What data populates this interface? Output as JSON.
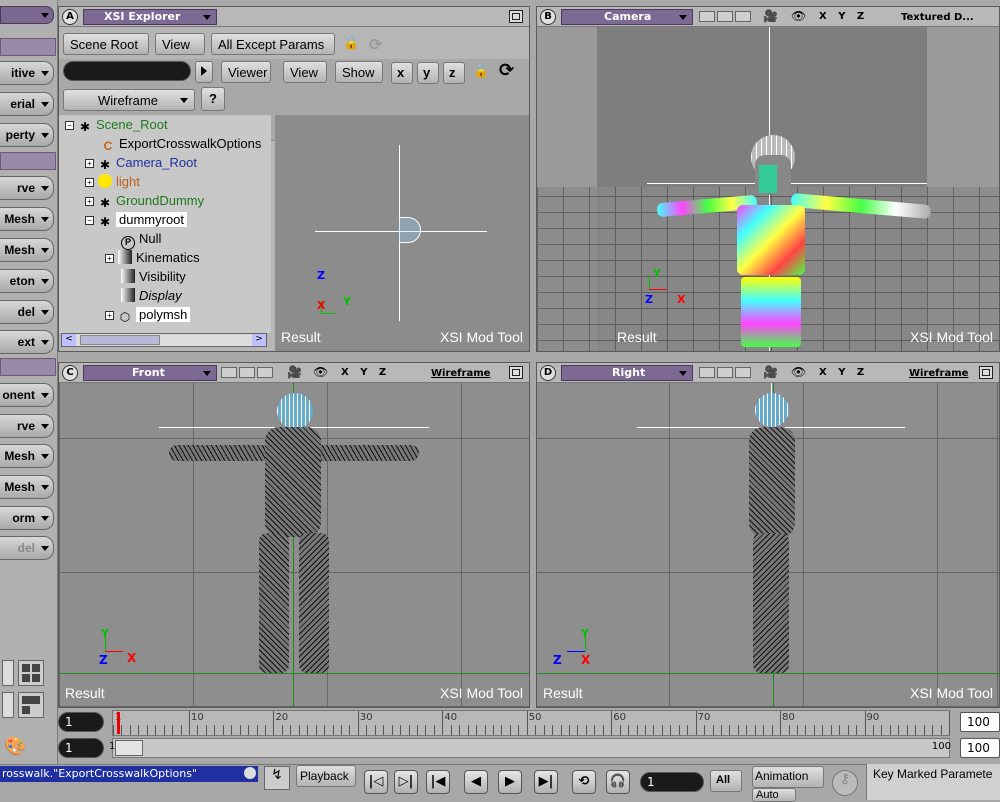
{
  "left_toolbar": {
    "items": [
      "itive",
      "erial",
      "perty",
      "rve",
      "Mesh",
      "Mesh",
      "eton",
      "del",
      "ext",
      "onent",
      "rve",
      "Mesh",
      "Mesh",
      "orm",
      "del"
    ]
  },
  "explorer": {
    "letter": "A",
    "title": "XSI Explorer",
    "scope_button": "Scene Root",
    "view_button": "View",
    "filter_button": "All Except Params",
    "viewer_button": "Viewer",
    "view2_button": "View",
    "show_button": "Show",
    "axis_x": "x",
    "axis_y": "y",
    "axis_z": "z",
    "wireframe_button": "Wireframe",
    "help_button": "?",
    "tree": [
      {
        "label": "Scene_Root",
        "color": "#1f7a1f"
      },
      {
        "label": "ExportCrosswalkOptions",
        "color": "#000000"
      },
      {
        "label": "Camera_Root",
        "color": "#2030a0"
      },
      {
        "label": "light",
        "color": "#c0601a"
      },
      {
        "label": "GroundDummy",
        "color": "#1f7a1f"
      },
      {
        "label": "dummyroot",
        "color": "#000000"
      },
      {
        "label": "Null",
        "color": "#000000"
      },
      {
        "label": "Kinematics",
        "color": "#000000"
      },
      {
        "label": "Visibility",
        "color": "#000000"
      },
      {
        "label": "Display",
        "color": "#000000"
      },
      {
        "label": "polymsh",
        "color": "#000000"
      }
    ],
    "mini_labels": {
      "result": "Result",
      "right": "XSI  Mod  Tool"
    },
    "mini_axes": {
      "z": "Z",
      "x": "X",
      "y": "Y"
    }
  },
  "viewports": {
    "b": {
      "letter": "B",
      "title": "Camera",
      "mode": "Textured D...",
      "xyz": "X Y Z"
    },
    "c": {
      "letter": "C",
      "title": "Front",
      "mode": "Wireframe",
      "xyz": "X Y Z"
    },
    "d": {
      "letter": "D",
      "title": "Right",
      "mode": "Wireframe",
      "xyz": "X Y Z"
    },
    "result_label": "Result",
    "tool_label": "XSI  Mod  Tool",
    "axis_z": "Z",
    "axis_x": "X",
    "axis_y": "Y"
  },
  "timeline": {
    "start_field": "1",
    "end_field": "100",
    "range_start": "1",
    "range_end": "100",
    "range_end_field": "100",
    "range_tick_start": "1",
    "range_tick_end": "100",
    "ticks": [
      "1",
      "10",
      "20",
      "30",
      "40",
      "50",
      "60",
      "70",
      "80",
      "90"
    ]
  },
  "playback": {
    "selection_text": "rosswalk.\"ExportCrosswalkOptions\"",
    "playback_button": "Playback",
    "frame_field": "1",
    "all_button": "All",
    "animation_button": "Animation",
    "auto_button": "Auto",
    "key_marked_label": "Key Marked Paramete"
  }
}
